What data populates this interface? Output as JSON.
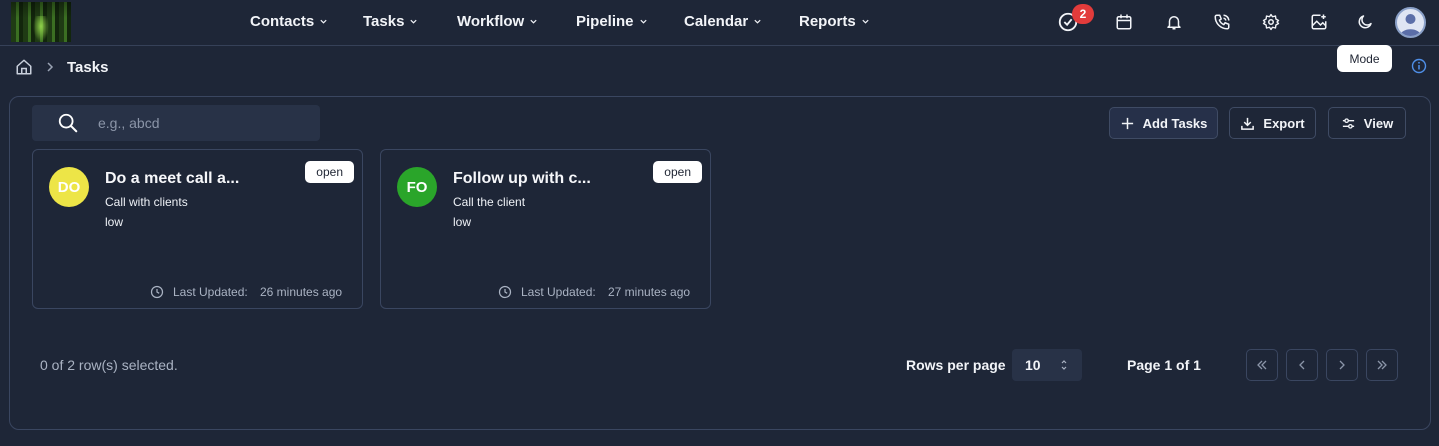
{
  "nav": {
    "items": [
      {
        "label": "Contacts"
      },
      {
        "label": "Tasks"
      },
      {
        "label": "Workflow"
      },
      {
        "label": "Pipeline"
      },
      {
        "label": "Calendar"
      },
      {
        "label": "Reports"
      }
    ],
    "tasks_badge": "2",
    "tooltip": "Mode"
  },
  "breadcrumb": {
    "current": "Tasks"
  },
  "toolbar": {
    "search_placeholder": "e.g., abcd",
    "add_label": "Add Tasks",
    "export_label": "Export",
    "view_label": "View"
  },
  "cards": [
    {
      "initials": "DO",
      "avatar_color": "#ede547",
      "initials_color": "#ffffff",
      "title": "Do a meet call a...",
      "subtitle": "Call with clients",
      "priority": "low",
      "status": "open",
      "updated_label": "Last Updated:",
      "updated_value": "26 minutes ago"
    },
    {
      "initials": "FO",
      "avatar_color": "#2aa52a",
      "initials_color": "#ffffff",
      "title": "Follow up with c...",
      "subtitle": "Call the client",
      "priority": "low",
      "status": "open",
      "updated_label": "Last Updated:",
      "updated_value": "27 minutes ago"
    }
  ],
  "footer": {
    "selected_text": "0 of 2 row(s) selected.",
    "rows_per_page_label": "Rows per page",
    "rows_per_page_value": "10",
    "page_label": "Page 1 of 1"
  },
  "colors": {
    "background": "#1e2637",
    "badge": "#e23b3b"
  }
}
